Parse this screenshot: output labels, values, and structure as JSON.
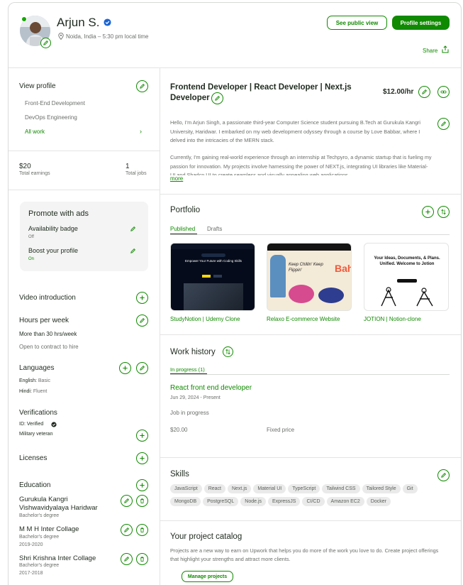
{
  "header": {
    "name": "Arjun S.",
    "location": "Noida, India – 5:30 pm local time",
    "public_view_label": "See public view",
    "settings_label": "Profile settings",
    "share_label": "Share"
  },
  "sidebar": {
    "view_profile_title": "View profile",
    "profiles": [
      "Front-End Development",
      "DevOps Engineering",
      "All work"
    ],
    "earnings_value": "$20",
    "earnings_label": "Total earnings",
    "jobs_value": "1",
    "jobs_label": "Total jobs",
    "promote": {
      "title": "Promote with ads",
      "availability_label": "Availability badge",
      "availability_status": "Off",
      "boost_label": "Boost your profile",
      "boost_status": "On"
    },
    "video_title": "Video introduction",
    "hours_title": "Hours per week",
    "hours_value": "More than 30 hrs/week",
    "hours_note": "Open to contract to hire",
    "languages_title": "Languages",
    "lang1_name": "English:",
    "lang1_level": "Basic",
    "lang2_name": "Hindi:",
    "lang2_level": "Fluent",
    "verifications_title": "Verifications",
    "id_verified": "ID: Verified",
    "military": "Military veteran",
    "licenses_title": "Licenses",
    "education_title": "Education",
    "education": [
      {
        "school": "Gurukula Kangri Vishwavidyalaya Haridwar",
        "degree": "Bachelor's degree",
        "years": ""
      },
      {
        "school": "M M H Inter Collage",
        "degree": "Bachelor's degree",
        "years": "2019-2020"
      },
      {
        "school": "Shri Krishna Inter Collage",
        "degree": "Bachelor's degree",
        "years": "2017-2018"
      }
    ]
  },
  "main": {
    "title_line1": "Frontend Developer | React Developer | Next.js",
    "title_line2": "Developer",
    "rate": "$12.00/hr",
    "bio_p1": "Hello, I'm Arjun Singh, a passionate third-year Computer Science student pursuing B.Tech at Gurukula Kangri University, Haridwar. I embarked on my web development odyssey through a course by Love Babbar, where I delved into the intricacies of the MERN stack.",
    "bio_p2": "Currently, I'm gaining real-world experience through an internship at Techpyro, a dynamic startup that is fueling my passion for innovation. My projects involve harnessing the power of NEXT.js, integrating UI libraries like Material-UI and Shadcn UI to create seamless and visually appealing web applications.",
    "more_label": "more",
    "portfolio_title": "Portfolio",
    "portfolio_tabs": [
      "Published",
      "Drafts"
    ],
    "portfolio_items": [
      {
        "title": "StudyNotion | Udemy Clone",
        "thumb_headline": "Empower Your Future with Coding Skills"
      },
      {
        "title": "Relaxo E-commerce Website",
        "thumb_headline": "Keep Chillin' Keep Flippin'",
        "thumb_brand": "Bah"
      },
      {
        "title": "JOTION | Notion-clone",
        "thumb_headline": "Your Ideas, Documents, & Plans. Unified. Welcome to Jotion"
      }
    ],
    "work_title": "Work history",
    "work_tab": "In progress (1)",
    "job_title": "React front end developer",
    "job_date": "Jun 29, 2024 - Present",
    "job_status": "Job in progress",
    "job_amount": "$20.00",
    "job_type": "Fixed price",
    "skills_title": "Skills",
    "skills": [
      "JavaScript",
      "React",
      "Next.js",
      "Material UI",
      "TypeScript",
      "Tailwind CSS",
      "Tailored Style",
      "Git",
      "MongoDB",
      "PostgreSQL",
      "Node.js",
      "ExpressJS",
      "CI/CD",
      "Amazon EC2",
      "Docker"
    ],
    "catalog_title": "Your project catalog",
    "catalog_text": "Projects are a new way to earn on Upwork that helps you do more of the work you love to do. Create project offerings that highlight your strengths and attract more clients.",
    "manage_label": "Manage projects"
  },
  "colors": {
    "accent": "#108a00",
    "border": "#d8dad8",
    "verified_badge": "#1a64d6"
  }
}
